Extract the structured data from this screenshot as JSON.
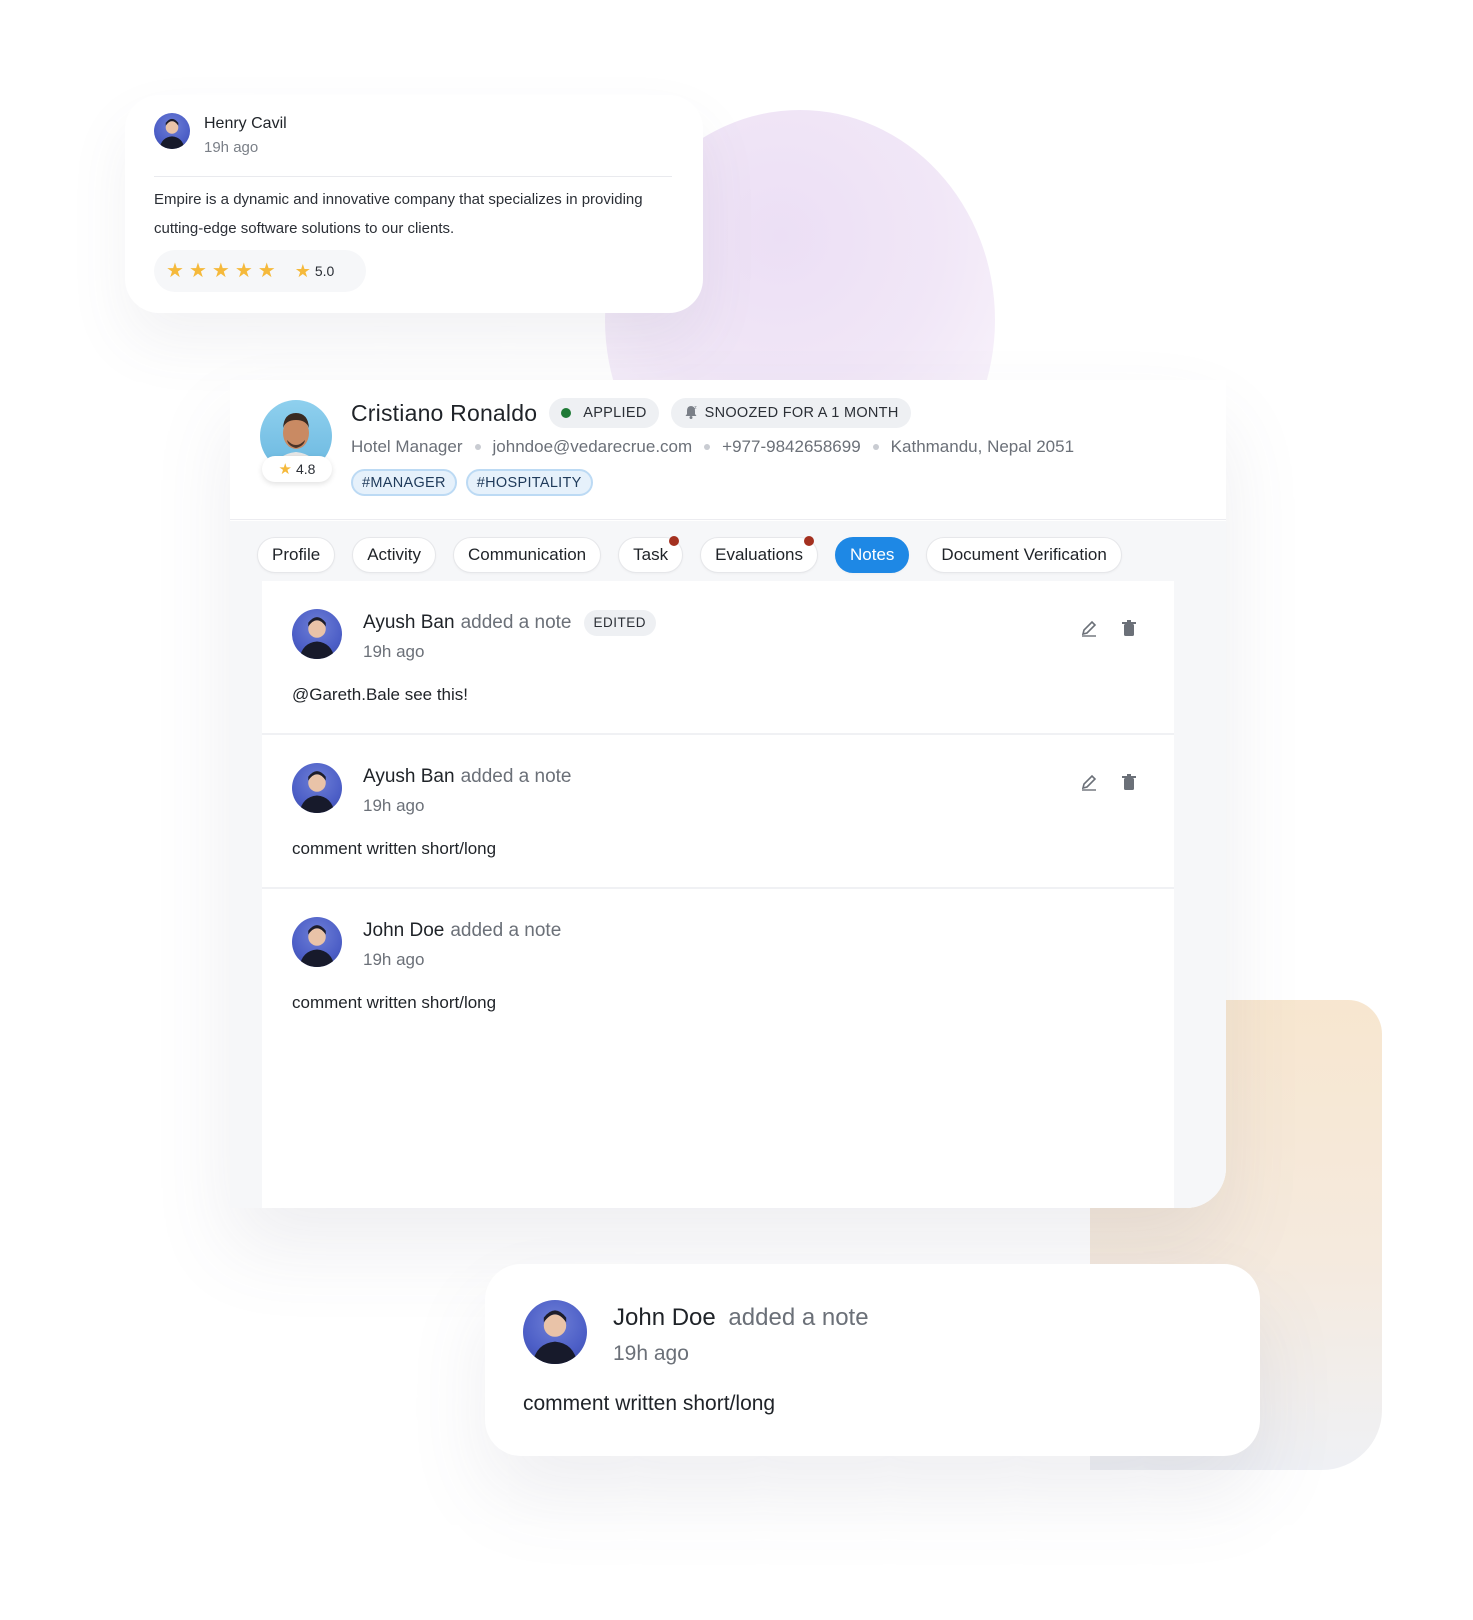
{
  "review": {
    "name": "Henry Cavil",
    "time": "19h ago",
    "text": "Empire is a dynamic and innovative company that specializes in providing cutting-edge software solutions to our clients.",
    "stars": 5,
    "rating": "5.0"
  },
  "candidate": {
    "name": "Cristiano Ronaldo",
    "rating": "4.8",
    "status": "APPLIED",
    "snooze": "SNOOZED FOR A 1 MONTH",
    "role": "Hotel Manager",
    "email": "johndoe@vedarecrue.com",
    "phone": "+977-9842658699",
    "location": "Kathmandu, Nepal 2051",
    "tags": [
      "#MANAGER",
      "#HOSPITALITY"
    ]
  },
  "tabs": [
    {
      "label": "Profile",
      "dot": false,
      "active": false
    },
    {
      "label": "Activity",
      "dot": false,
      "active": false
    },
    {
      "label": "Communication",
      "dot": false,
      "active": false
    },
    {
      "label": "Task",
      "dot": true,
      "active": false
    },
    {
      "label": "Evaluations",
      "dot": true,
      "active": false
    },
    {
      "label": "Notes",
      "dot": false,
      "active": true
    },
    {
      "label": "Document Verification",
      "dot": false,
      "active": false
    }
  ],
  "notes": [
    {
      "author": "Ayush Ban",
      "action": "added a note",
      "edited": "EDITED",
      "time": "19h ago",
      "body": "@Gareth.Bale see this!",
      "tools": true
    },
    {
      "author": "Ayush Ban",
      "action": "added a note",
      "edited": "",
      "time": "19h ago",
      "body": "comment written short/long",
      "tools": true
    },
    {
      "author": "John Doe",
      "action": "added a note",
      "edited": "",
      "time": "19h ago",
      "body": "comment written short/long",
      "tools": false
    }
  ],
  "floating_note": {
    "author": "John Doe",
    "action": "added a note",
    "time": "19h ago",
    "body": "comment written short/long"
  },
  "colors": {
    "accent": "#1e88e5",
    "star": "#f5b93b",
    "status_green": "#1f7a36",
    "tab_dot": "#a3301f"
  }
}
